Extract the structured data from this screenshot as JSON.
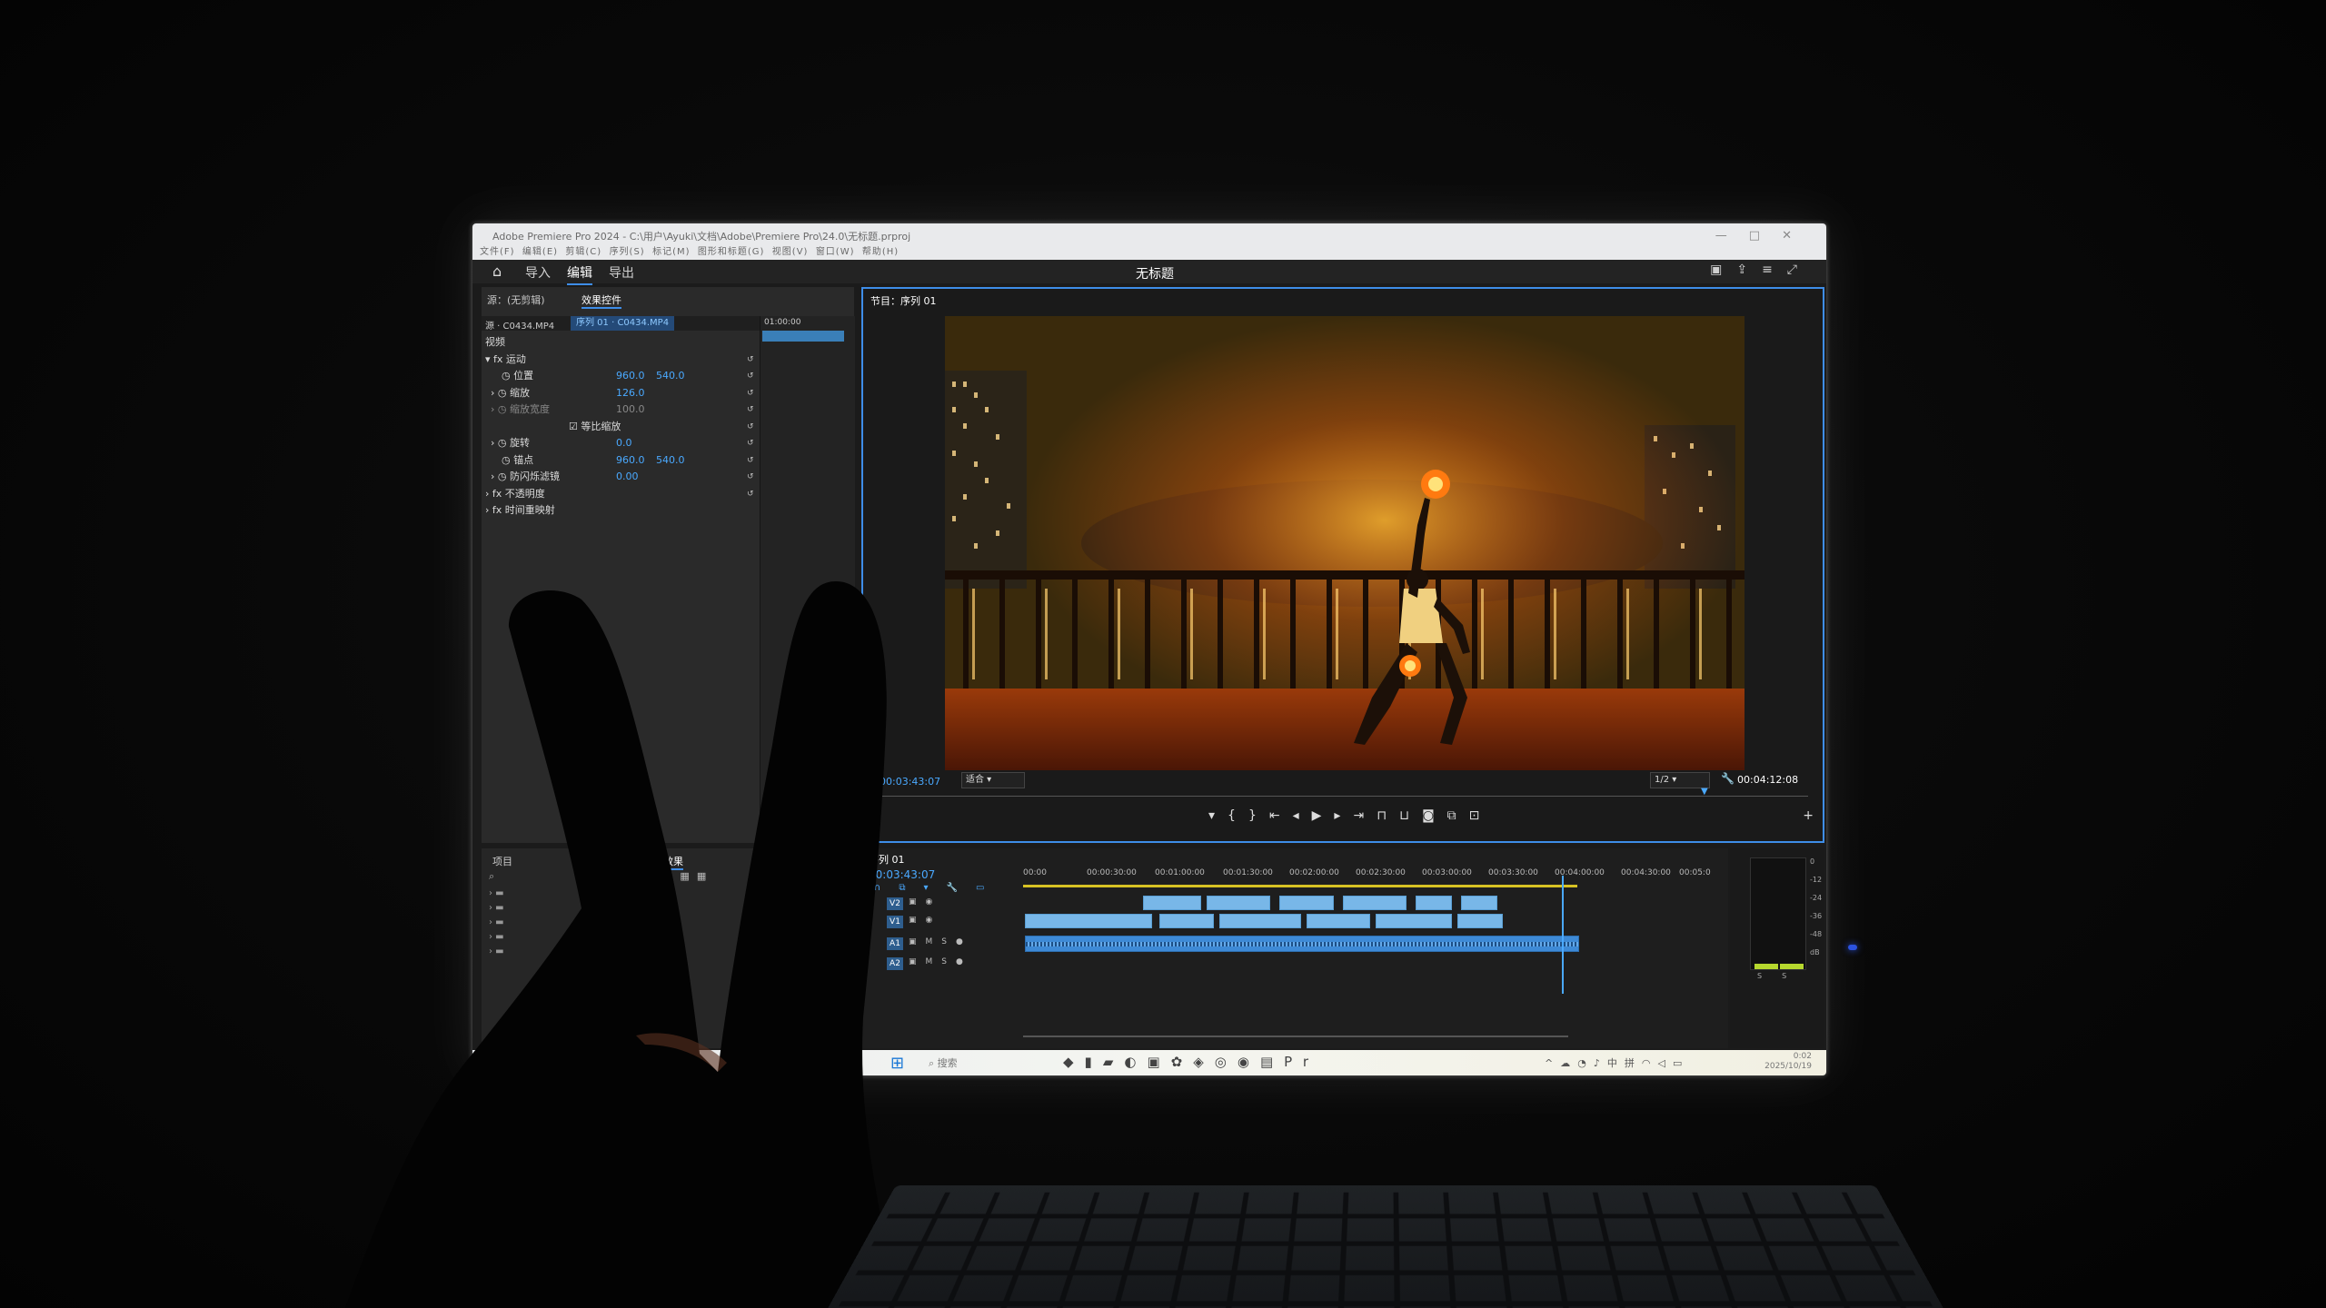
{
  "window": {
    "title": "Adobe Premiere Pro 2024 - C:\\用户\\Ayuki\\文档\\Adobe\\Premiere Pro\\24.0\\无标题.prproj",
    "menu": [
      "文件(F)",
      "编辑(E)",
      "剪辑(C)",
      "序列(S)",
      "标记(M)",
      "图形和标题(G)",
      "视图(V)",
      "窗口(W)",
      "帮助(H)"
    ],
    "controls": [
      "—",
      "□",
      "✕"
    ]
  },
  "app_header": {
    "tabs": [
      "导入",
      "编辑",
      "导出"
    ],
    "active_tab": "编辑",
    "document_title": "无标题"
  },
  "effect_controls": {
    "panel_source": "源：(无剪辑)",
    "panel_title": "效果控件",
    "source_clip": "源 · C0434.MP4",
    "sequence_clip": "序列 01 · C0434.MP4",
    "timeline_time": "01:00:00",
    "section": "视频",
    "properties": [
      {
        "label": "运动",
        "v1": "",
        "v2": ""
      },
      {
        "label": "位置",
        "v1": "960.0",
        "v2": "540.0"
      },
      {
        "label": "缩放",
        "v1": "126.0",
        "v2": ""
      },
      {
        "label": "缩放宽度",
        "v1": "100.0",
        "v2": ""
      },
      {
        "label": "等比缩放",
        "v1": "",
        "v2": ""
      },
      {
        "label": "旋转",
        "v1": "0.0",
        "v2": ""
      },
      {
        "label": "锚点",
        "v1": "960.0",
        "v2": "540.0"
      },
      {
        "label": "防闪烁滤镜",
        "v1": "0.00",
        "v2": ""
      },
      {
        "label": "不透明度",
        "v1": "",
        "v2": ""
      },
      {
        "label": "时间重映射",
        "v1": "",
        "v2": ""
      }
    ]
  },
  "program_monitor": {
    "title": "节目：序列 01",
    "current_timecode": "00:03:43:07",
    "fit": "适合",
    "resolution": "1/2",
    "duration": "00:04:12:08"
  },
  "project_panel": {
    "title": "项目",
    "tab2": "效果"
  },
  "timeline": {
    "title": "序列 01",
    "timecode": "00:03:43:07",
    "ruler": [
      "00:00",
      "00:00:30:00",
      "00:01:00:00",
      "00:01:30:00",
      "00:02:00:00",
      "00:02:30:00",
      "00:03:00:00",
      "00:03:30:00",
      "00:04:00:00",
      "00:04:30:00",
      "00:05:0"
    ],
    "tracks": [
      "V2",
      "V1",
      "A1",
      "A2"
    ],
    "playhead_fraction": 0.78
  },
  "audio_meter": {
    "scale": [
      "0",
      "-12",
      "-24",
      "-36",
      "-48",
      "dB"
    ],
    "channels": [
      "S",
      "S"
    ]
  },
  "taskbar": {
    "search_placeholder": "搜索",
    "time": "0:02",
    "date": "2025/10/19",
    "ime": "中"
  }
}
